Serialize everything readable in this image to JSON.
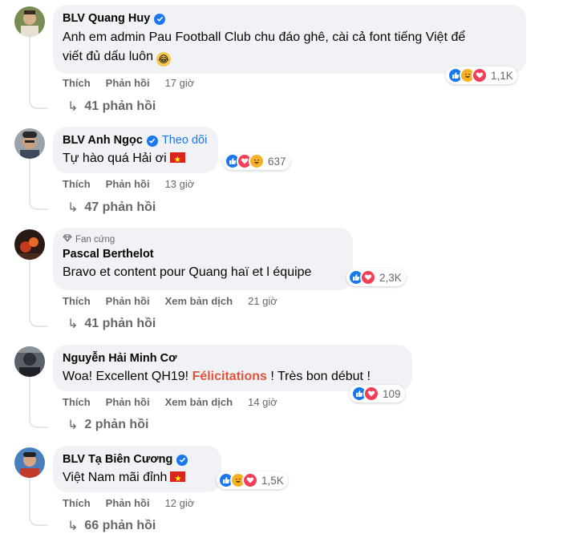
{
  "comments": [
    {
      "name": "BLV Quang Huy",
      "verified": true,
      "text_line1": "Anh em admin Pau Football Club chu đáo ghê, cài cả font tiếng Việt để",
      "text_line2": "viết đủ dấu luôn",
      "actions": {
        "like": "Thích",
        "reply": "Phản hồi",
        "time": "17 giờ"
      },
      "reaction_count": "1,1K",
      "replies": "41 phản hồi"
    },
    {
      "name": "BLV Anh Ngọc",
      "verified": true,
      "follow": "Theo dõi",
      "text": "Tự hào quá Hải ơi",
      "actions": {
        "like": "Thích",
        "reply": "Phản hồi",
        "time": "13 giờ"
      },
      "reaction_count": "637",
      "replies": "47 phản hồi"
    },
    {
      "badge": "Fan cứng",
      "name": "Pascal Berthelot",
      "text": "Bravo et content pour Quang haï et l équipe",
      "actions": {
        "like": "Thích",
        "reply": "Phản hồi",
        "translate": "Xem bản dịch",
        "time": "21 giờ"
      },
      "reaction_count": "2,3K",
      "replies": "41 phản hồi"
    },
    {
      "name": "Nguyễn Hải Minh Cơ",
      "text_part1": "Woa! Excellent QH19! ",
      "text_highlight": "Félicitations",
      "text_part2": " ! Très bon début !",
      "actions": {
        "like": "Thích",
        "reply": "Phản hồi",
        "translate": "Xem bản dịch",
        "time": "14 giờ"
      },
      "reaction_count": "109",
      "replies": "2 phản hồi"
    },
    {
      "name": "BLV Tạ Biên Cương",
      "verified": true,
      "text": "Việt Nam mãi đỉnh",
      "actions": {
        "like": "Thích",
        "reply": "Phản hồi",
        "time": "12 giờ"
      },
      "reaction_count": "1,5K",
      "replies": "66 phản hồi"
    }
  ],
  "icons": {
    "like": "like-reaction-icon",
    "love": "love-reaction-icon",
    "haha": "haha-reaction-icon",
    "verified": "verified-badge-icon",
    "fan": "diamond-icon",
    "reply_arrow": "reply-arrow-icon"
  },
  "colors": {
    "bubble": "#f0f2f5",
    "link_blue": "#1877f2",
    "secondary_text": "#65676b",
    "highlight": "#e0543c"
  }
}
